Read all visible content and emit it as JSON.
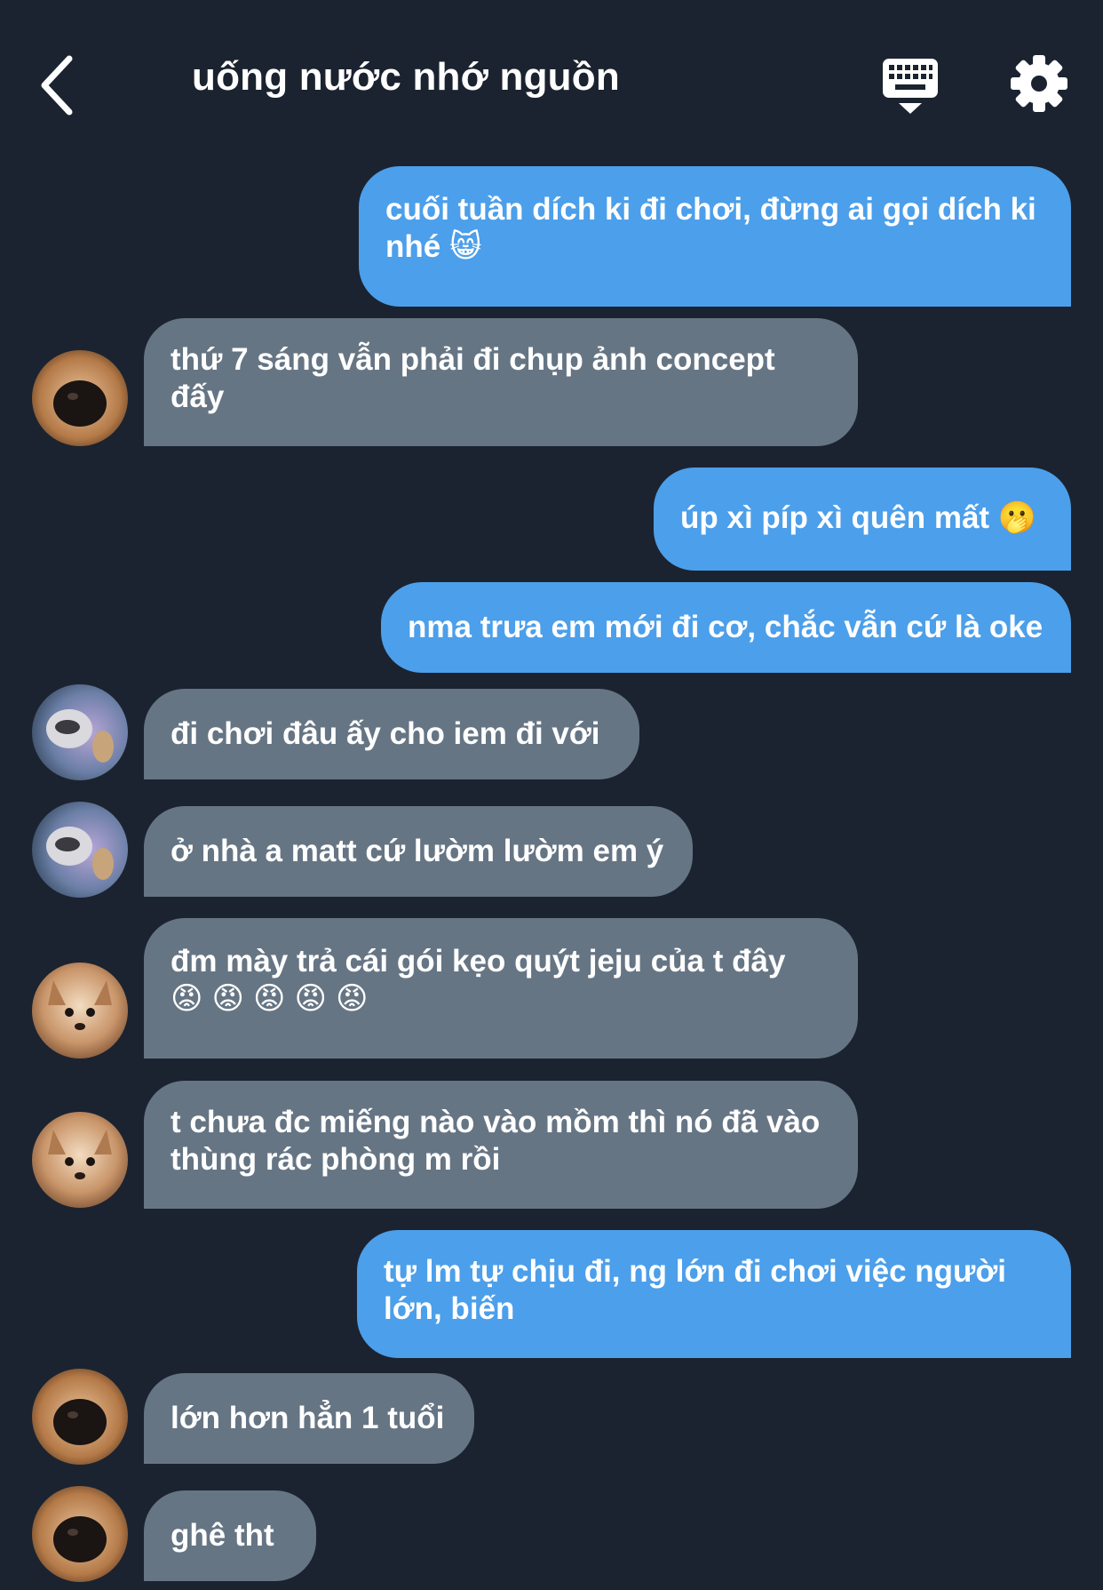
{
  "header": {
    "title": "uống nước nhớ nguồn",
    "back_icon": "chevron-left-icon",
    "keyboard_icon": "keyboard-icon",
    "settings_icon": "gear-icon"
  },
  "colors": {
    "background": "#1b2330",
    "outgoing_bubble": "#4c9fea",
    "incoming_bubble": "#667584",
    "text": "#ffffff"
  },
  "messages": [
    {
      "direction": "out",
      "text": "cuối tuần dích ki đi chơi, đừng ai gọi dích ki nhé 😸"
    },
    {
      "direction": "in",
      "avatar": "dog-avatar",
      "text": "thứ 7 sáng vẫn phải đi chụp ảnh concept đấy"
    },
    {
      "direction": "out",
      "text": "úp xì píp xì quên mất 🫢"
    },
    {
      "direction": "out",
      "text": "nma trưa em mới đi cơ, chắc vẫn cứ là oke"
    },
    {
      "direction": "in",
      "avatar": "raccoon-avatar",
      "text": "đi chơi đâu ấy cho iem đi với"
    },
    {
      "direction": "in",
      "avatar": "raccoon-avatar",
      "text": "ở nhà a matt cứ lườm lườm em ý"
    },
    {
      "direction": "in",
      "avatar": "chihuahua-avatar",
      "text": "đm mày trả cái gói kẹo quýt jeju của t đây",
      "emoji": "😡😡😡😡😡"
    },
    {
      "direction": "in",
      "avatar": "chihuahua-avatar",
      "text": "t chưa đc miếng nào vào mồm thì nó đã vào thùng rác phòng m rồi"
    },
    {
      "direction": "out",
      "text": "tự lm tự chịu đi, ng lớn đi chơi việc người lớn, biến"
    },
    {
      "direction": "in",
      "avatar": "dog-avatar",
      "text": "lớn hơn hẳn 1 tuổi"
    },
    {
      "direction": "in",
      "avatar": "dog-avatar",
      "text": "ghê tht"
    }
  ]
}
